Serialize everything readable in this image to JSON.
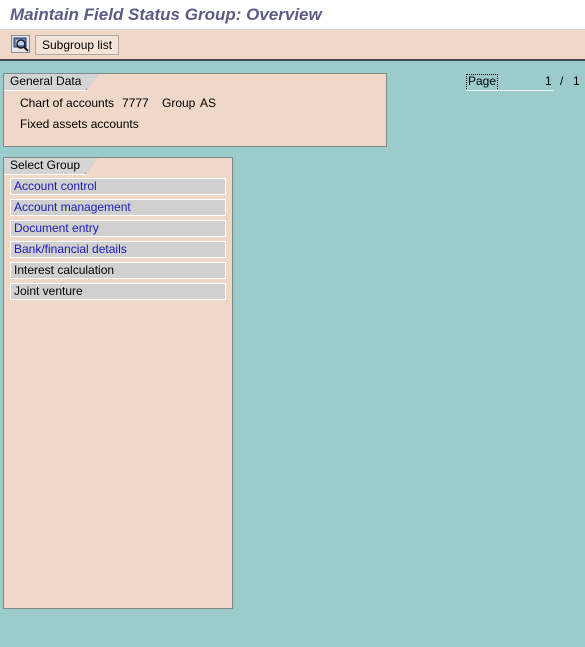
{
  "window": {
    "title": "Maintain Field Status Group: Overview"
  },
  "toolbar": {
    "icon": "magnifier-icon",
    "subgroup_list_label": "Subgroup list"
  },
  "general_data": {
    "tab_label": "General Data",
    "chart_of_accounts_label": "Chart of accounts",
    "chart_of_accounts_value": "7777",
    "group_label": "Group",
    "group_value": "AS",
    "description": "Fixed assets accounts"
  },
  "paging": {
    "label": "Page",
    "current": "1",
    "separator": "/",
    "total": "1"
  },
  "select_group": {
    "tab_label": "Select Group",
    "items": [
      {
        "label": "Account control",
        "style": "link"
      },
      {
        "label": "Account management",
        "style": "link"
      },
      {
        "label": "Document entry",
        "style": "link"
      },
      {
        "label": "Bank/financial details",
        "style": "link"
      },
      {
        "label": "Interest calculation",
        "style": "plain"
      },
      {
        "label": "Joint venture",
        "style": "plain"
      }
    ]
  },
  "colors": {
    "background": "#9bcbcb",
    "panel": "#f0d8c8",
    "title_text": "#5c5c84",
    "link_text": "#1a1ab0"
  }
}
